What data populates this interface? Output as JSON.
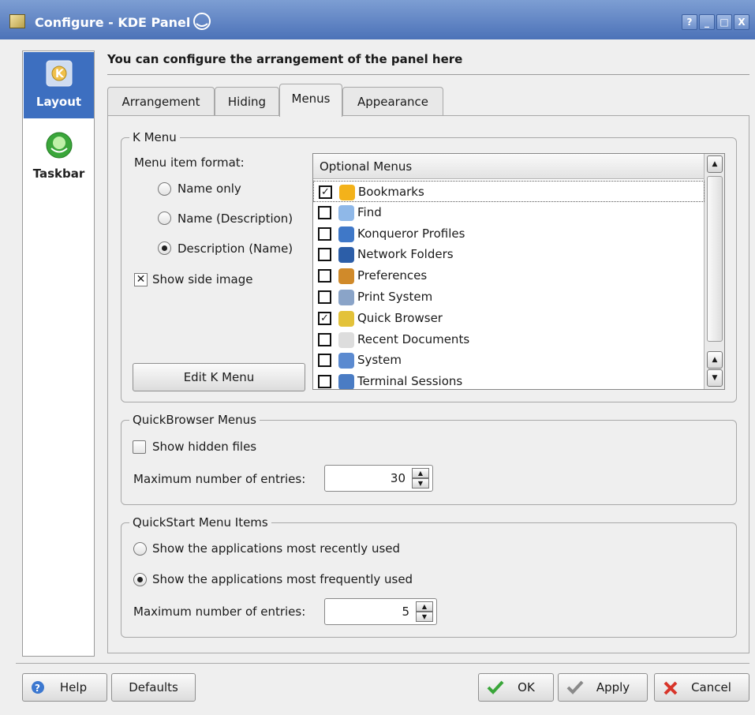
{
  "window": {
    "title": "Configure - KDE Panel",
    "buttons": [
      "?",
      "_",
      "□",
      "X"
    ]
  },
  "sidebar": {
    "items": [
      {
        "label": "Layout",
        "icon": "kde-gear-icon",
        "active": true
      },
      {
        "label": "Taskbar",
        "icon": "taskbar-icon",
        "active": false
      }
    ]
  },
  "heading": "You can configure the arrangement of the panel here",
  "tabs": [
    {
      "label": "Arrangement",
      "active": false
    },
    {
      "label": "Hiding",
      "active": false
    },
    {
      "label": "Menus",
      "active": true
    },
    {
      "label": "Appearance",
      "active": false
    }
  ],
  "kmenu": {
    "legend": "K Menu",
    "format_label": "Menu item format:",
    "options": [
      {
        "label": "Name only",
        "checked": false
      },
      {
        "label": "Name (Description)",
        "checked": false
      },
      {
        "label": "Description (Name)",
        "checked": true
      }
    ],
    "side_image": {
      "label": "Show side image",
      "checked": true
    },
    "edit_button": "Edit K Menu",
    "optional_menus": {
      "header": "Optional Menus",
      "items": [
        {
          "label": "Bookmarks",
          "checked": true,
          "icon": "star-icon",
          "color": "#f3b21a"
        },
        {
          "label": "Find",
          "checked": false,
          "icon": "magnifier-icon",
          "color": "#8fb8e8"
        },
        {
          "label": "Konqueror Profiles",
          "checked": false,
          "icon": "konqueror-icon",
          "color": "#3f78c8"
        },
        {
          "label": "Network Folders",
          "checked": false,
          "icon": "globe-icon",
          "color": "#2c5ea8"
        },
        {
          "label": "Preferences",
          "checked": false,
          "icon": "wrench-icon",
          "color": "#d08a2a"
        },
        {
          "label": "Print System",
          "checked": false,
          "icon": "printer-icon",
          "color": "#8aa4c8"
        },
        {
          "label": "Quick Browser",
          "checked": true,
          "icon": "quick-browser-icon",
          "color": "#e3c23a"
        },
        {
          "label": "Recent Documents",
          "checked": false,
          "icon": "document-icon",
          "color": "#dddddd"
        },
        {
          "label": "System",
          "checked": false,
          "icon": "system-icon",
          "color": "#5b8ad0"
        },
        {
          "label": "Terminal Sessions",
          "checked": false,
          "icon": "terminal-icon",
          "color": "#4a7cc4"
        }
      ]
    }
  },
  "quickbrowser": {
    "legend": "QuickBrowser Menus",
    "show_hidden": {
      "label": "Show hidden files",
      "checked": false
    },
    "max_label": "Maximum number of entries:",
    "max_value": "30"
  },
  "quickstart": {
    "legend": "QuickStart Menu Items",
    "options": [
      {
        "label": "Show the applications most recently used",
        "checked": false
      },
      {
        "label": "Show the applications most frequently used",
        "checked": true
      }
    ],
    "max_label": "Maximum number of entries:",
    "max_value": "5"
  },
  "footer": {
    "help": "Help",
    "defaults": "Defaults",
    "ok": "OK",
    "apply": "Apply",
    "cancel": "Cancel"
  }
}
